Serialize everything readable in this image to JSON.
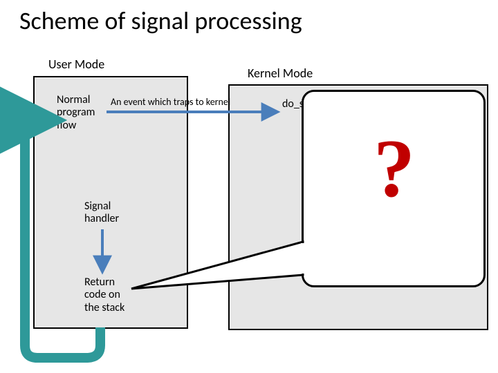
{
  "title": "Scheme of signal processing",
  "labels": {
    "user_mode": "User Mode",
    "kernel_mode": "Kernel Mode"
  },
  "blocks": {
    "normal_program_flow_l1": "Normal",
    "normal_program_flow_l2": "program",
    "normal_program_flow_l3": "flow",
    "event_trap": "An event which traps to kernel",
    "do_sig": "do_sig",
    "signal_handler_l1": "Signal",
    "signal_handler_l2": "handler",
    "return_code_l1": "Return",
    "return_code_l2": "code on",
    "return_code_l3": "the stack"
  },
  "callout": {
    "question_mark": "?"
  },
  "colors": {
    "accent_red": "#c00000",
    "arrow_blue": "#4a7ebb",
    "arrow_teal": "#2e9999"
  }
}
